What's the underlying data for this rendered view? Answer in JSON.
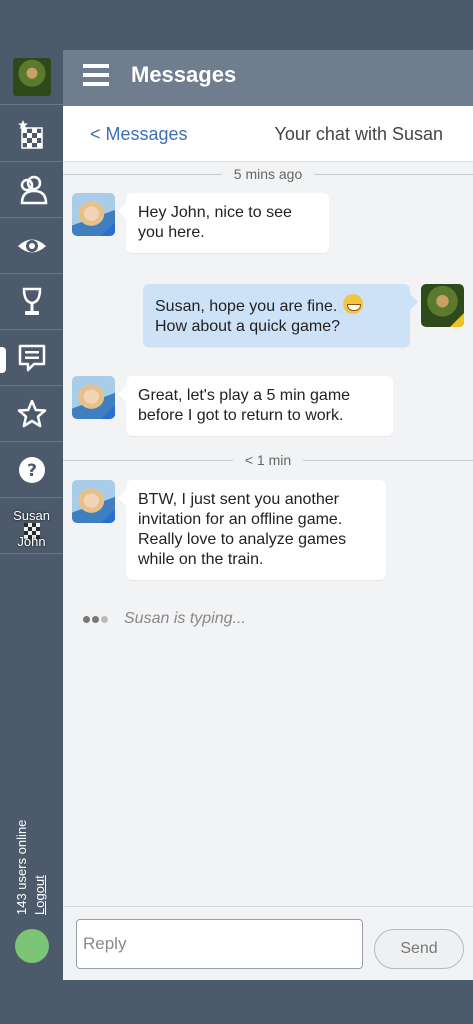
{
  "header": {
    "title": "Messages"
  },
  "subheader": {
    "back_label": "< Messages",
    "chat_title": "Your chat with Susan"
  },
  "sidebar": {
    "game": {
      "player1": "Susan",
      "player2": "John"
    },
    "online_users": "143 users online",
    "logout_label": "Logout",
    "status_color": "#7cc576"
  },
  "chat": {
    "dividers": [
      {
        "label": "5 mins ago"
      },
      {
        "label": "< 1 min"
      }
    ],
    "messages": [
      {
        "from": "Susan",
        "text": "Hey John, nice to see you here."
      },
      {
        "from": "John",
        "text": "Susan, hope you are fine.",
        "text2": "How about a quick game?"
      },
      {
        "from": "Susan",
        "text": "Great, let's play a 5 min game before I got to return to work."
      },
      {
        "from": "Susan",
        "text": "BTW, I just sent you another invitation for an offline game. Really love to analyze games while on the train."
      }
    ],
    "typing": "Susan is typing..."
  },
  "composer": {
    "placeholder": "Reply",
    "send_label": "Send"
  }
}
